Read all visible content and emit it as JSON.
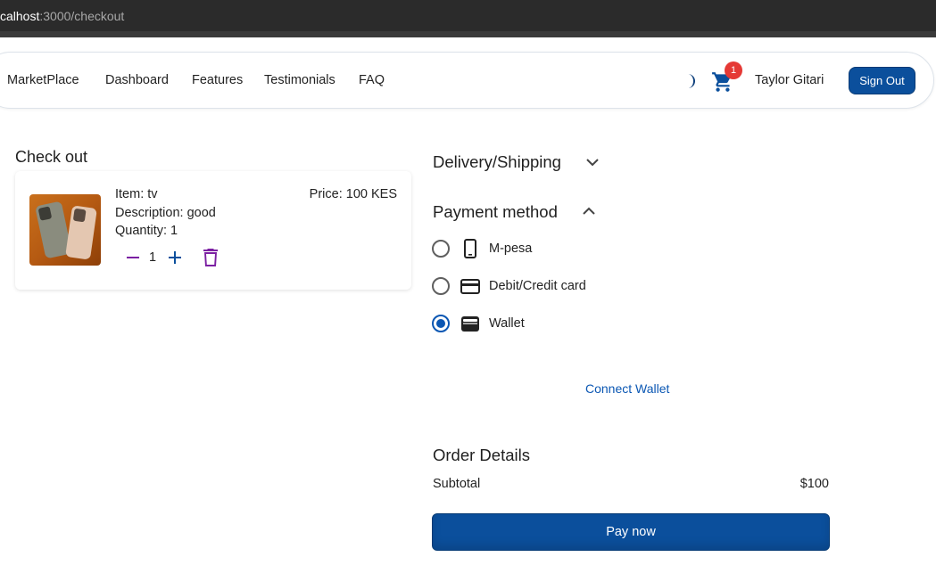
{
  "browser": {
    "url_host": "calhost",
    "url_path": ":3000/checkout"
  },
  "navbar": {
    "brand": "MarketPlace",
    "links": [
      "Dashboard",
      "Features",
      "Testimonials",
      "FAQ"
    ],
    "cart_count": "1",
    "user_name": "Taylor Gitari",
    "sign_out_label": "Sign Out",
    "icons": {
      "theme": "moon-icon",
      "cart": "cart-icon"
    }
  },
  "checkout": {
    "title": "Check out",
    "item": {
      "name_line": "Item: tv",
      "description_line": "Description: good",
      "quantity_line": "Quantity: 1",
      "price_line": "Price: 100 KES",
      "quantity_value": "1",
      "image": "phones-photo"
    }
  },
  "delivery": {
    "title": "Delivery/Shipping",
    "expanded": false
  },
  "payment": {
    "title": "Payment method",
    "expanded": true,
    "options": [
      {
        "label": "M-pesa",
        "icon": "smartphone-icon",
        "selected": false
      },
      {
        "label": "Debit/Credit card",
        "icon": "credit-card-icon",
        "selected": false
      },
      {
        "label": "Wallet",
        "icon": "wallet-icon",
        "selected": true
      }
    ],
    "connect_wallet_label": "Connect Wallet"
  },
  "order": {
    "title": "Order Details",
    "subtotal_label": "Subtotal",
    "subtotal_value": "$100",
    "pay_label": "Pay now"
  },
  "colors": {
    "primary": "#0b4f9c",
    "accent_blue": "#0b57b3",
    "badge_red": "#e53935",
    "qty_purple": "#7b1fa2"
  }
}
